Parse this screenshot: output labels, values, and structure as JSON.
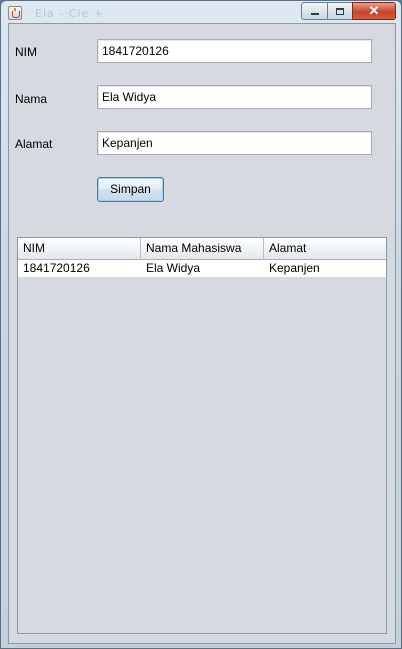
{
  "window": {
    "title_ghost": "Ela - Cle +",
    "caption": {
      "minimize": "",
      "maximize": "",
      "close": "✕"
    }
  },
  "form": {
    "nim_label": "NIM",
    "nim_value": "1841720126",
    "nama_label": "Nama",
    "nama_value": "Ela Widya",
    "alamat_label": "Alamat",
    "alamat_value": "Kepanjen",
    "save_label": "Simpan"
  },
  "table": {
    "columns": [
      "NIM",
      "Nama Mahasiswa",
      "Alamat"
    ],
    "rows": [
      [
        "1841720126",
        "Ela Widya",
        "Kepanjen"
      ]
    ]
  },
  "colors": {
    "frame": "#cbd7e3",
    "client": "#d6d9df",
    "close_button": "#c7452c",
    "button_border": "#3c7fb1"
  }
}
